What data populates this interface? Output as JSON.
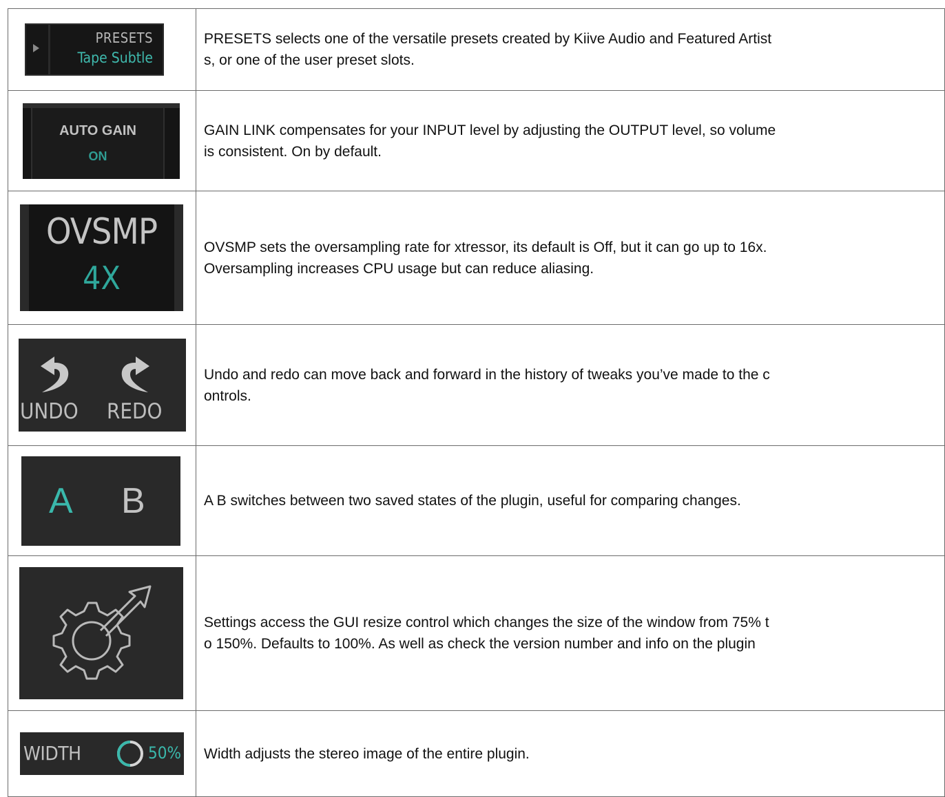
{
  "rows": [
    {
      "image": {
        "title": "PRESETS",
        "value": "Tape Subtle",
        "icon": "triangle-right-icon"
      },
      "lines": [
        "PRESETS selects one of the versatile presets created by Kiive Audio and Featured Artist",
        "s, or one of the user preset slots."
      ]
    },
    {
      "image": {
        "title": "AUTO GAIN",
        "value": "ON"
      },
      "lines": [
        "GAIN LINK compensates for your INPUT level by adjusting the OUTPUT level, so volume",
        "is consistent. On by default."
      ]
    },
    {
      "image": {
        "title": "OVSMP",
        "value": "4X"
      },
      "lines": [
        "OVSMP sets the oversampling rate for xtressor, its default is Off, but it can go up to 16x.",
        "Oversampling increases CPU usage but can reduce aliasing."
      ]
    },
    {
      "image": {
        "undo": "UNDO",
        "redo": "REDO",
        "icons": [
          "undo-arrow-icon",
          "redo-arrow-icon"
        ]
      },
      "lines": [
        "Undo and redo can move back and forward in the history of tweaks you’ve made to the c",
        "ontrols."
      ]
    },
    {
      "image": {
        "a": "A",
        "b": "B"
      },
      "lines": [
        "A B switches between two saved states of the plugin, useful for comparing changes."
      ]
    },
    {
      "image": {
        "icon": "settings-gear-arrow-icon"
      },
      "lines": [
        "Settings access the GUI resize control which changes the size of the window from 75% t",
        "o 150%. Defaults to 100%. As well as check the version number and info on the plugin"
      ]
    },
    {
      "image": {
        "title": "WIDTH",
        "value": "50%",
        "level": 0.5,
        "icon": "width-ring-icon"
      },
      "lines": [
        "Width adjusts the stereo image of the entire plugin."
      ]
    }
  ],
  "colors": {
    "accent": "#3ab8ab",
    "panel": "#292929",
    "label": "#c0c0c0"
  }
}
